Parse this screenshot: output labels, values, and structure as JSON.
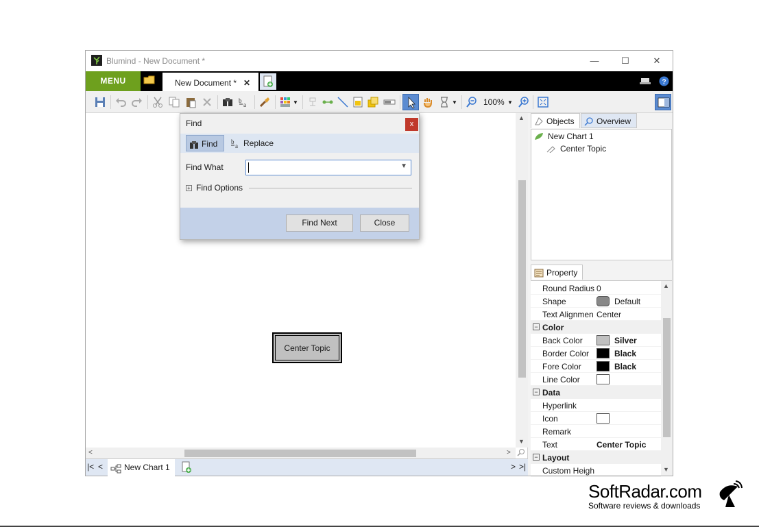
{
  "window": {
    "title": "Blumind - New Document *",
    "controls": {
      "minimize": "—",
      "maximize": "☐",
      "close": "✕"
    }
  },
  "menubar": {
    "menu_label": "MENU",
    "document_tab": "New Document *",
    "document_tab_close": "✕"
  },
  "toolbar": {
    "zoom": "100%"
  },
  "canvas": {
    "center_topic": "Center Topic"
  },
  "chart_tabs": {
    "active": "New Chart 1"
  },
  "right_panel": {
    "tabs": [
      "Objects",
      "Overview"
    ],
    "tree": {
      "root": "New Chart 1",
      "child": "Center Topic"
    },
    "property_tab": "Property",
    "properties": {
      "round_radius": {
        "name": "Round Radius",
        "value": "0"
      },
      "shape": {
        "name": "Shape",
        "value": "Default"
      },
      "text_alignment": {
        "name": "Text Alignmen",
        "value": "Center"
      },
      "cat_color": "Color",
      "back_color": {
        "name": "Back Color",
        "value": "Silver",
        "swatch": "#c0c0c0"
      },
      "border_color": {
        "name": "Border Color",
        "value": "Black",
        "swatch": "#000000"
      },
      "fore_color": {
        "name": "Fore Color",
        "value": "Black",
        "swatch": "#000000"
      },
      "line_color": {
        "name": "Line Color",
        "swatch": "#ffffff"
      },
      "cat_data": "Data",
      "hyperlink": {
        "name": "Hyperlink"
      },
      "icon": {
        "name": "Icon"
      },
      "remark": {
        "name": "Remark"
      },
      "text": {
        "name": "Text",
        "value": "Center Topic"
      },
      "cat_layout": "Layout",
      "custom_height": {
        "name": "Custom Heigh"
      }
    }
  },
  "find_dialog": {
    "title": "Find",
    "close": "x",
    "tabs": {
      "find": "Find",
      "replace": "Replace"
    },
    "find_what_label": "Find What",
    "find_what_value": "",
    "find_options": "Find Options",
    "find_next": "Find Next",
    "close_button": "Close"
  },
  "watermark": {
    "title": "SoftRadar.com",
    "subtitle": "Software reviews & downloads"
  },
  "colors": {
    "menu_green": "#6ea01e",
    "menubar_black": "#000000",
    "dialog_footer": "#c3d1e8",
    "selected_tab": "#b8c9e2"
  }
}
